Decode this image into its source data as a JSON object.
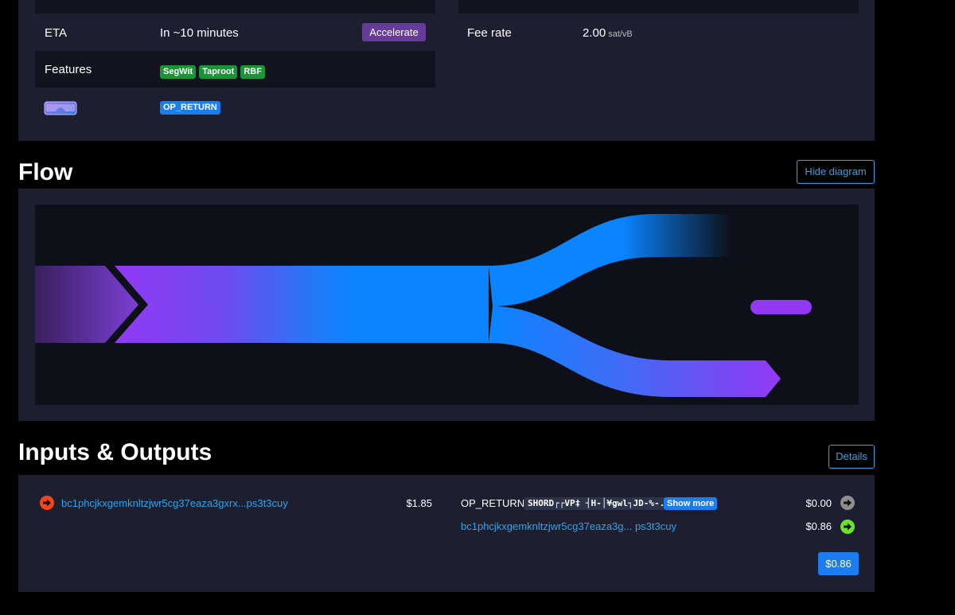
{
  "details": {
    "eta_label": "ETA",
    "eta_value": "In ~10 minutes",
    "accelerate_label": "Accelerate",
    "features_label": "Features",
    "features": [
      "SegWit",
      "Taproot",
      "RBF"
    ],
    "op_return_badge": "OP_RETURN",
    "fee_rate_label": "Fee rate",
    "fee_rate_value": "2.00",
    "fee_rate_unit": "sat/vB"
  },
  "flow": {
    "title": "Flow",
    "hide_button": "Hide diagram"
  },
  "io": {
    "title": "Inputs & Outputs",
    "details_button": "Details",
    "inputs": [
      {
        "address": "bc1phcjkxgemknltzjwr5cg37eaza3gxrx...ps3t3cuy",
        "amount": "$1.85"
      }
    ],
    "outputs": [
      {
        "type": "OP_RETURN",
        "data": "SHORD┌┌VP‡ ┤H-│¥gwl┐JD-%-...",
        "show_more": "Show more",
        "amount": "$0.00"
      },
      {
        "address": "bc1phcjkxgemknltzjwr5cg37eaza3g... ps3t3cuy",
        "amount": "$0.86"
      }
    ],
    "total": "$0.86"
  },
  "colors": {
    "card_bg": "#1d1f31",
    "row_dark": "#11131f",
    "link": "#2fa4e7",
    "accent_purple": "#653b9c",
    "badge_green": "#1a9436",
    "badge_blue": "#1a7df0",
    "input_arrow": "#f1461b",
    "output_green": "#6ae42a",
    "output_grey": "#8e8e8e"
  }
}
